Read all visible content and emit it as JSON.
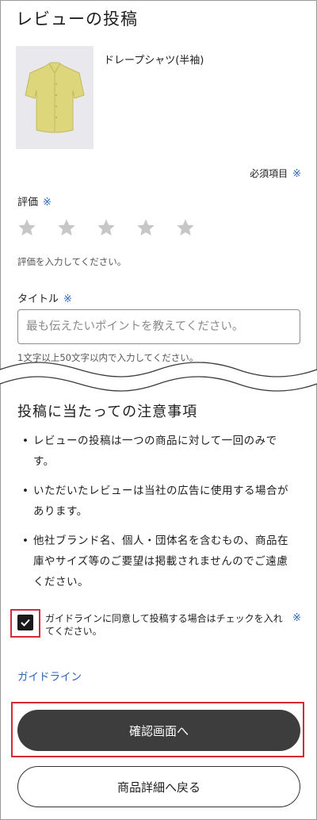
{
  "header": {
    "title": "レビューの投稿"
  },
  "product": {
    "name": "ドレープシャツ(半袖)"
  },
  "form": {
    "required_note": "必須項目",
    "required_mark": "※",
    "rating": {
      "label": "評価",
      "value": 0,
      "max": 5,
      "hint": "評価を入力してください。"
    },
    "title_field": {
      "label": "タイトル",
      "placeholder": "最も伝えたいポイントを教えてください。",
      "value": "",
      "hint": "1文字以上50文字以内で入力してください。"
    }
  },
  "notice": {
    "title": "投稿に当たっての注意事項",
    "items": [
      "レビューの投稿は一つの商品に対して一回のみです。",
      "いただいたレビューは当社の広告に使用する場合があります。",
      "他社ブランド名、個人・団体名を含むもの、商品在庫やサイズ等のご要望は掲載されませんのでご遠慮ください。"
    ]
  },
  "agreement": {
    "checked": true,
    "text": "ガイドラインに同意して投稿する場合はチェックを入れてください。",
    "mark": "※"
  },
  "links": {
    "guideline": "ガイドライン"
  },
  "buttons": {
    "confirm": "確認画面へ",
    "back": "商品詳細へ戻る"
  },
  "colors": {
    "accent_blue": "#2b64b8",
    "highlight_red": "#d52b37",
    "button_dark": "#3d3d3d",
    "star_empty": "#c7c7c7"
  },
  "icons": {
    "star": "star-icon",
    "check": "checkmark-icon"
  }
}
